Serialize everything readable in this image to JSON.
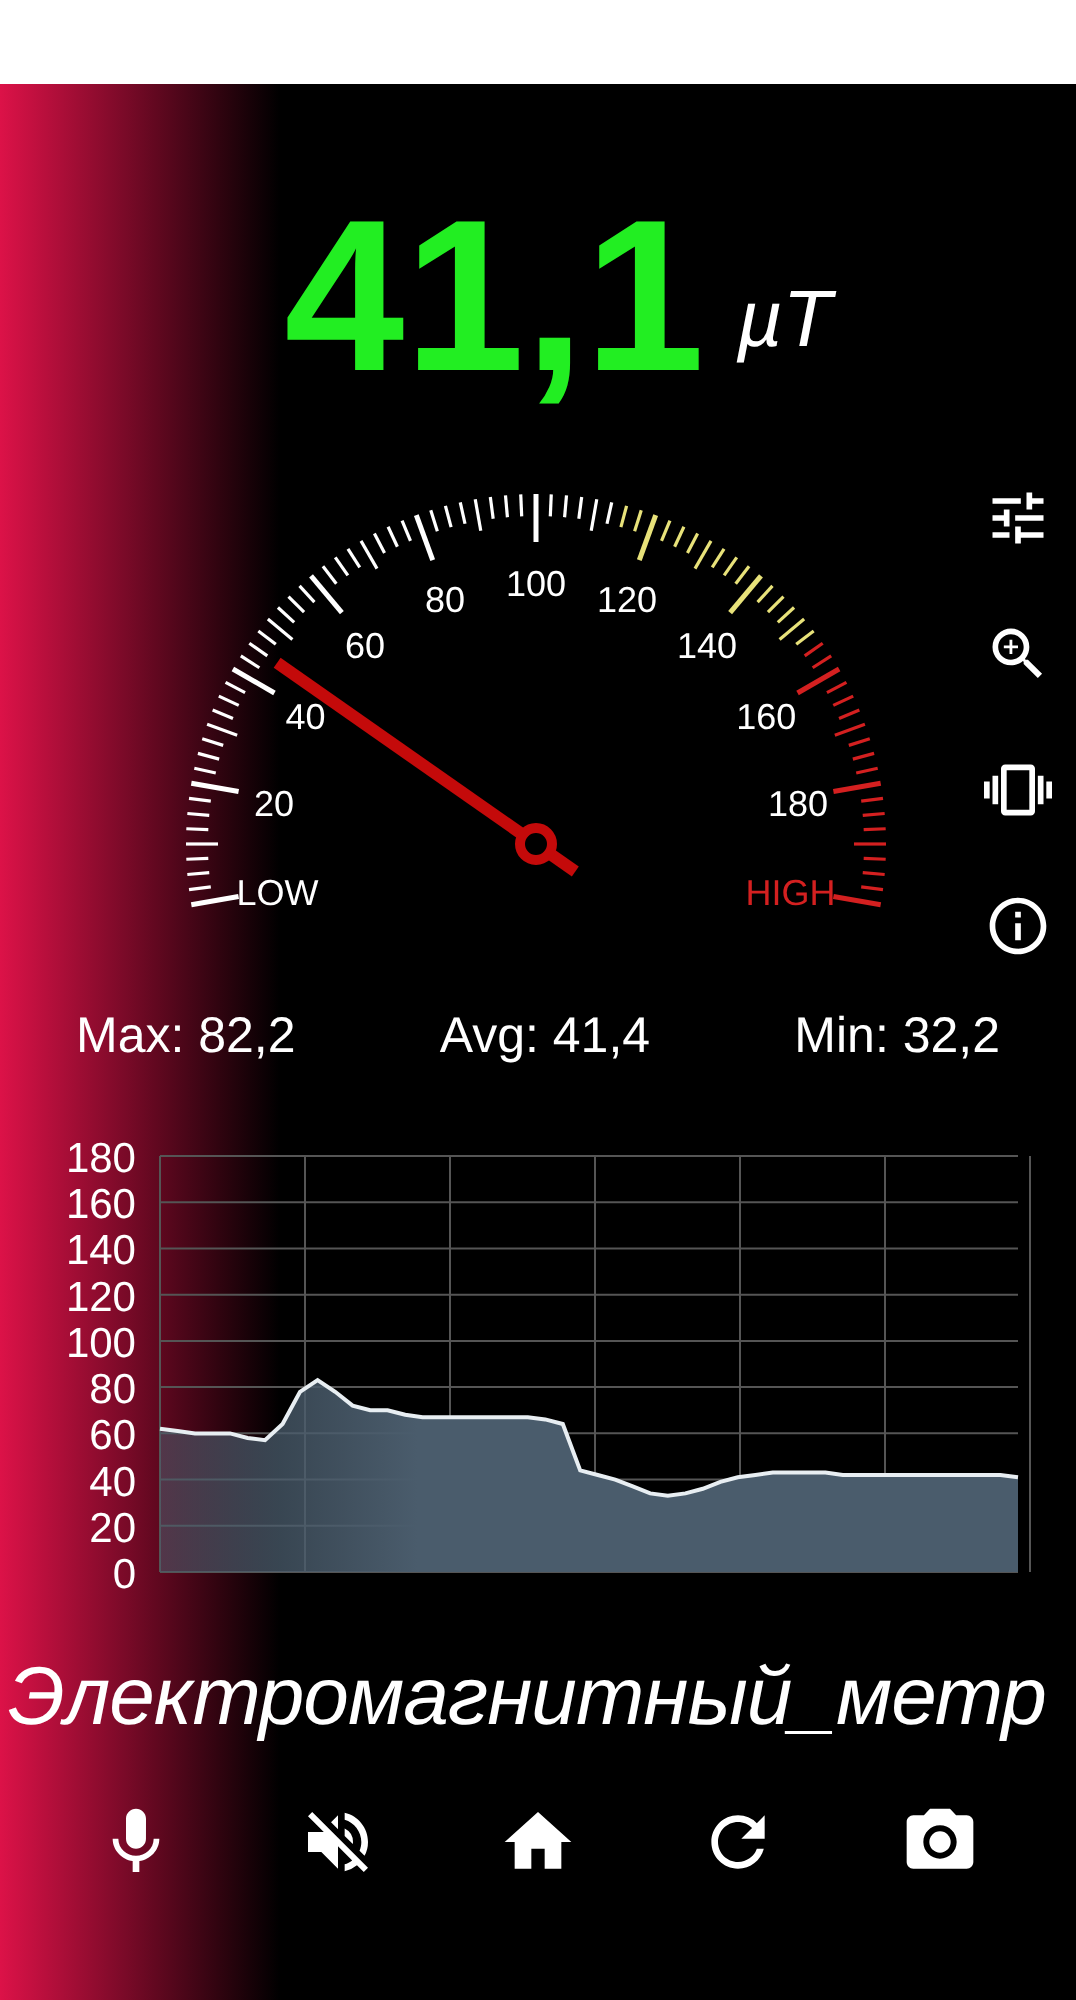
{
  "reading": {
    "value": "41,1",
    "unit": "µT"
  },
  "gauge": {
    "low_label": "LOW",
    "high_label": "HIGH",
    "scale_labels": [
      "20",
      "40",
      "60",
      "80",
      "100",
      "120",
      "140",
      "160",
      "180"
    ]
  },
  "side_toolbar": [
    {
      "kind": "tune"
    },
    {
      "kind": "zoom"
    },
    {
      "kind": "vibrate"
    },
    {
      "kind": "info"
    }
  ],
  "stats": [
    "Max: 82,2",
    "Avg: 41,4",
    "Min: 32,2"
  ],
  "history": {
    "chart_data": {
      "type": "area",
      "grid": true,
      "ylim": [
        0,
        180
      ],
      "yticks": [
        0,
        20,
        40,
        60,
        80,
        100,
        120,
        140,
        160,
        180
      ],
      "series": [
        {
          "color": "#4a5c6c",
          "values": [
            62,
            61,
            60,
            60,
            60,
            58,
            57,
            64,
            78,
            83,
            78,
            72,
            70,
            70,
            68,
            67,
            67,
            67,
            67,
            67,
            67,
            67,
            66,
            64,
            44,
            42,
            40,
            37,
            34,
            33,
            34,
            36,
            39,
            41,
            42,
            43,
            43,
            43,
            43,
            42,
            42,
            42,
            42,
            42,
            42,
            42,
            42,
            42,
            42,
            41
          ]
        }
      ]
    }
  },
  "app_title": "Электромагнитный_метр",
  "bottom_bar": [
    {
      "kind": "mic"
    },
    {
      "kind": "mute"
    },
    {
      "kind": "home"
    },
    {
      "kind": "refresh"
    },
    {
      "kind": "camera"
    }
  ]
}
